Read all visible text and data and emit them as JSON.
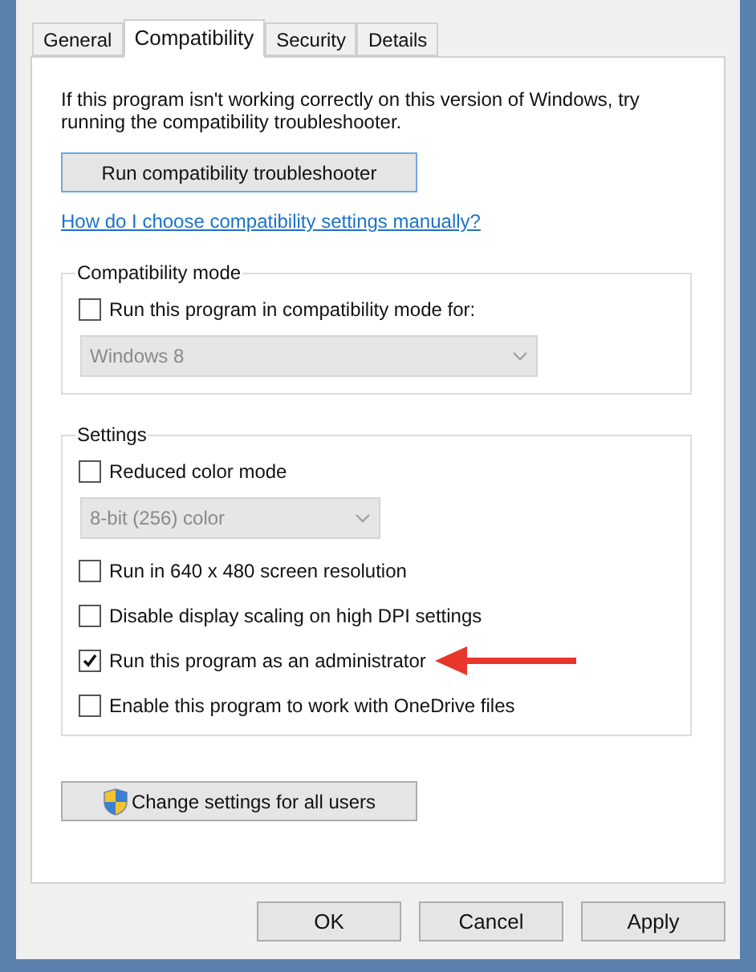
{
  "tabs": [
    {
      "label": "General",
      "selected": false
    },
    {
      "label": "Compatibility",
      "selected": true
    },
    {
      "label": "Security",
      "selected": false
    },
    {
      "label": "Details",
      "selected": false
    }
  ],
  "intro": "If this program isn't working correctly on this version of Windows, try running the compatibility troubleshooter.",
  "troubleshoot_button": "Run compatibility troubleshooter",
  "help_link": "How do I choose compatibility settings manually?",
  "groups": [
    {
      "title": "Compatibility mode",
      "items": [
        {
          "kind": "checkbox",
          "label": "Run this program in compatibility mode for:",
          "checked": false
        },
        {
          "kind": "dropdown",
          "value": "Windows 8",
          "disabled": true
        }
      ]
    },
    {
      "title": "Settings",
      "items": [
        {
          "kind": "checkbox",
          "label": "Reduced color mode",
          "checked": false
        },
        {
          "kind": "dropdown",
          "value": "8-bit (256) color",
          "disabled": true
        },
        {
          "kind": "checkbox",
          "label": "Run in 640 x 480 screen resolution",
          "checked": false
        },
        {
          "kind": "checkbox",
          "label": "Disable display scaling on high DPI settings",
          "checked": false
        },
        {
          "kind": "checkbox",
          "label": "Run this program as an administrator",
          "checked": true,
          "annotated": true
        },
        {
          "kind": "checkbox",
          "label": "Enable this program to work with OneDrive files",
          "checked": false
        }
      ]
    }
  ],
  "all_users_button": "Change settings for all users",
  "buttons": [
    "OK",
    "Cancel",
    "Apply"
  ]
}
